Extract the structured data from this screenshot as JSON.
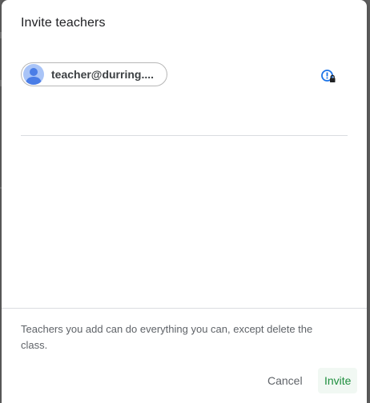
{
  "dialog": {
    "title": "Invite teachers",
    "recipients": [
      {
        "label": "teacher@durring...."
      }
    ],
    "note": "Teachers you add can do everything you can, except delete the class.",
    "cancel_label": "Cancel",
    "invite_label": "Invite"
  },
  "colors": {
    "accent": "#1e8e3e",
    "avatar_bg": "#a9c4f7",
    "avatar_fg": "#4a7de6"
  },
  "icons": {
    "avatar": "person-icon",
    "lock": "lock-info-icon"
  }
}
